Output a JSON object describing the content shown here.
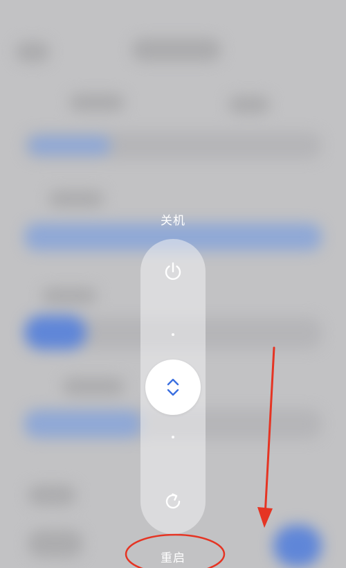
{
  "power_menu": {
    "top_label": "关机",
    "bottom_label": "重启",
    "power_icon": "power-icon",
    "restart_icon": "restart-icon",
    "handle_icon": "chevron-up-down-icon"
  },
  "colors": {
    "annotation": "#e53423",
    "handle_icon": "#3b6fe0",
    "pill": "#eeeeef"
  }
}
